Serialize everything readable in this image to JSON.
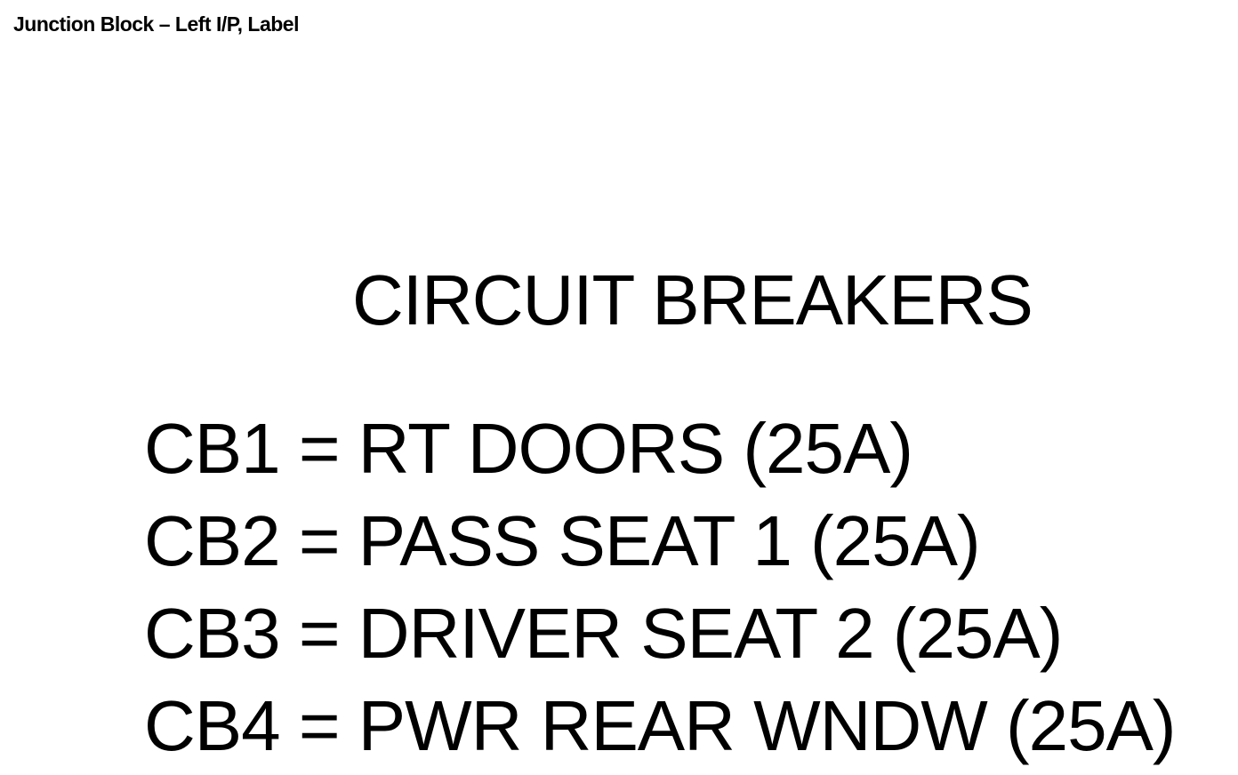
{
  "caption": "Junction Block – Left I/P, Label",
  "label": {
    "heading": "CIRCUIT BREAKERS",
    "breakers": [
      {
        "text": "CB1 = RT DOORS (25A)"
      },
      {
        "text": "CB2 = PASS SEAT 1 (25A)"
      },
      {
        "text": "CB3 = DRIVER SEAT 2 (25A)"
      },
      {
        "text": "CB4 = PWR REAR WNDW (25A)"
      }
    ]
  }
}
